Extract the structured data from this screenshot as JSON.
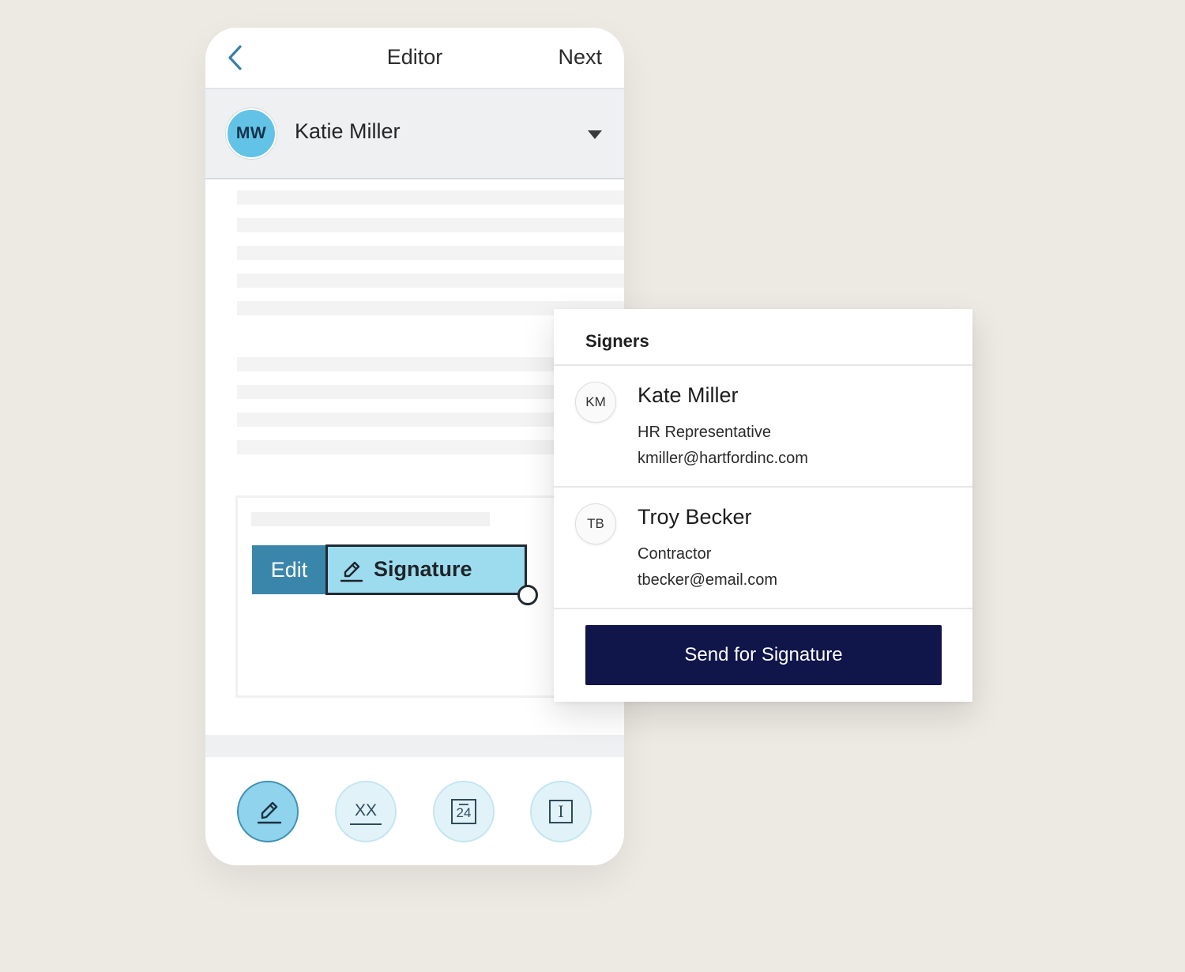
{
  "editor": {
    "title": "Editor",
    "next_label": "Next",
    "back_icon": "chevron-left-icon"
  },
  "recipient": {
    "initials": "MW",
    "name": "Katie Miller",
    "caret_icon": "caret-down-icon",
    "avatar_color": "#62c3e7"
  },
  "field": {
    "edit_label": "Edit",
    "signature_label": "Signature",
    "icon": "pen-icon",
    "fill_color": "#9ddcef",
    "edit_color": "#3a86aa"
  },
  "toolbar": {
    "tools": [
      {
        "icon": "signature-pen-icon",
        "active": true
      },
      {
        "icon": "initials-icon",
        "label": "XX"
      },
      {
        "icon": "calendar-date-icon",
        "label": "24"
      },
      {
        "icon": "text-field-icon",
        "label": "I"
      }
    ]
  },
  "signers": {
    "title": "Signers",
    "list": [
      {
        "initials": "KM",
        "name": "Kate Miller",
        "role": "HR Representative",
        "email": "kmiller@hartfordinc.com"
      },
      {
        "initials": "TB",
        "name": "Troy Becker",
        "role": "Contractor",
        "email": "tbecker@email.com"
      }
    ],
    "send_label": "Send for Signature",
    "button_color": "#10154a"
  }
}
